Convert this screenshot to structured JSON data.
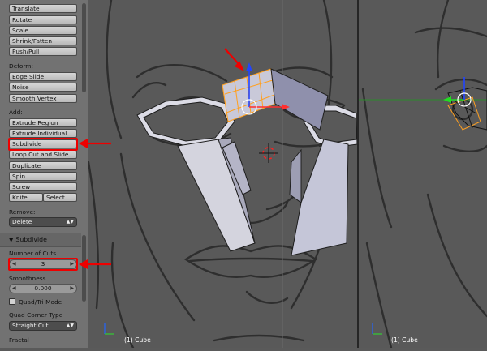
{
  "toolshelf": {
    "transform_buttons": [
      "Translate",
      "Rotate",
      "Scale",
      "Shrink/Fatten",
      "Push/Pull"
    ],
    "deform_label": "Deform:",
    "deform_buttons": [
      "Edge Slide",
      "Noise",
      "Smooth Vertex"
    ],
    "add_label": "Add:",
    "add_buttons": [
      "Extrude Region",
      "Extrude Individual",
      "Subdivide",
      "Loop Cut and Slide",
      "Duplicate",
      "Spin",
      "Screw"
    ],
    "knife": "Knife",
    "select": "Select",
    "remove_label": "Remove:",
    "delete": "Delete"
  },
  "operator": {
    "title": "Subdivide",
    "cuts_label": "Number of Cuts",
    "cuts_value": "3",
    "smooth_label": "Smoothness",
    "smooth_value": "0.000",
    "quad_tri": "Quad/Tri Mode",
    "corner_label": "Quad Corner Type",
    "corner_value": "Straight Cut",
    "fractal_label": "Fractal"
  },
  "viewport_main": {
    "label": "(1) Cube"
  },
  "viewport_side": {
    "label": "(1) Cube"
  },
  "colors": {
    "highlight": "#e00000",
    "panel_bg": "#727272",
    "viewport_bg": "#5a5a5a",
    "selection": "#ffa020"
  }
}
